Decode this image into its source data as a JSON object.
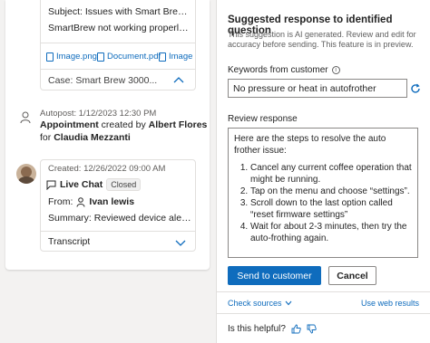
{
  "email": {
    "subject": "Subject: Issues with Smart Brew...",
    "snippet": "SmartBrew not working properly. I...",
    "attachments": [
      "Image.png",
      "Document.pdf",
      "Image"
    ],
    "case": "Case: Smart Brew 3000..."
  },
  "autopost": {
    "meta": "Autopost: 1/12/2023 12:30 PM",
    "title": "Appointment",
    "created_by_text": "created by",
    "creator": "Albert Flores",
    "for_text": "for",
    "target": "Claudia Mezzanti"
  },
  "chat": {
    "created": "Created: 12/26/2022 09:00 AM",
    "type": "Live Chat",
    "status": "Closed",
    "from_label": "From:",
    "from_name": "Ivan lewis",
    "summary": "Summary: Reviewed device alert...",
    "transcript": "Transcript"
  },
  "panel": {
    "title": "Suggested response to identified question",
    "description": "This suggestion is AI generated. Review and edit for accuracy before sending. This feature is in preview.",
    "keywords_label": "Keywords from customer",
    "keywords_value": "No pressure or heat in autofrother",
    "review_label": "Review response",
    "response_intro": "Here are the steps to resolve the auto frother issue:",
    "steps": [
      "Cancel any current coffee operation that might be running.",
      "Tap on the menu and choose “settings”.",
      "Scroll down to the last option called “reset firmware settings”",
      "Wait for about 2-3 minutes, then try the auto-frothing again."
    ],
    "send_label": "Send to customer",
    "cancel_label": "Cancel",
    "check_sources": "Check sources",
    "web_results": "Use web results",
    "helpful": "Is this helpful?"
  },
  "colors": {
    "accent": "#0f6cbd",
    "avatar_bg": "#c9b29a"
  }
}
